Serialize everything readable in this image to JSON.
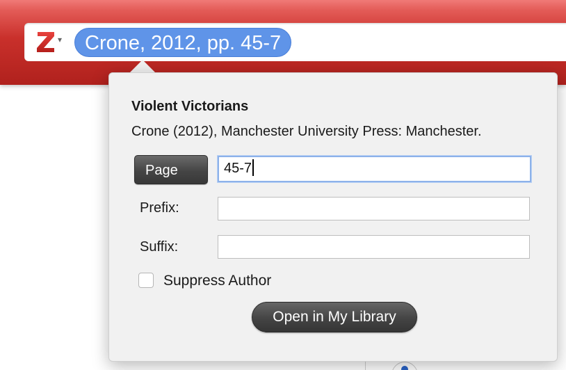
{
  "search_bar": {
    "citation_text": "Crone, 2012, pp. 45-7",
    "logo_icon": "zotero-z-icon",
    "dropdown_glyph": "▾",
    "brand_color": "#c9302b",
    "bubble_color": "#5f94e8"
  },
  "popover": {
    "title": "Violent Victorians",
    "meta": "Crone (2012), Manchester University Press: Manchester.",
    "locator": {
      "type_label": "Page",
      "value": "45-7"
    },
    "prefix": {
      "label": "Prefix:",
      "value": ""
    },
    "suffix": {
      "label": "Suffix:",
      "value": ""
    },
    "suppress_author": {
      "label": "Suppress Author",
      "checked": false
    },
    "open_button_label": "Open in My Library"
  }
}
